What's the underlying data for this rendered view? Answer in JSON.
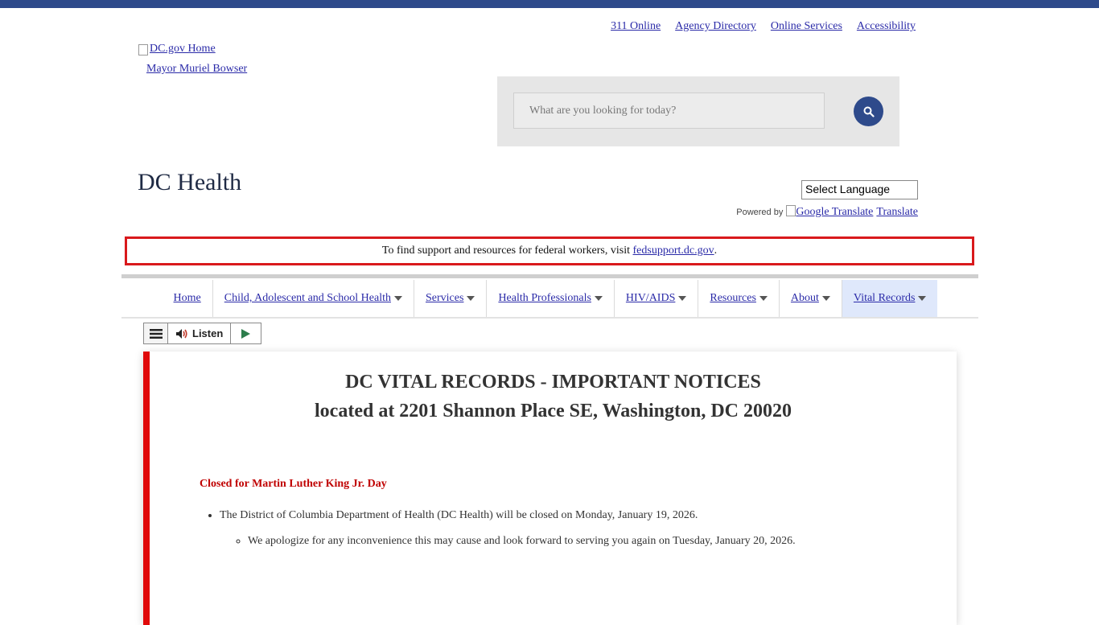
{
  "utility_links": [
    "311 Online",
    "Agency Directory",
    "Online Services",
    "Accessibility"
  ],
  "logo_alt": "DC.gov Home",
  "mayor_link": "Mayor Muriel Bowser",
  "search": {
    "placeholder": "What are you looking for today?"
  },
  "site_title": "DC Health",
  "language_select": "Select Language",
  "powered_by": "Powered by",
  "google_translate_alt": "Google Translate",
  "translate_link": "Translate",
  "alert": {
    "prefix": "To find support and resources for federal workers, visit ",
    "link": "fedsupport.dc.gov",
    "suffix": "."
  },
  "nav": [
    {
      "label": "Home",
      "dropdown": false,
      "active": false
    },
    {
      "label": "Child, Adolescent and School Health",
      "dropdown": true,
      "active": false
    },
    {
      "label": "Services",
      "dropdown": true,
      "active": false
    },
    {
      "label": "Health Professionals",
      "dropdown": true,
      "active": false
    },
    {
      "label": "HIV/AIDS",
      "dropdown": true,
      "active": false
    },
    {
      "label": "Resources",
      "dropdown": true,
      "active": false
    },
    {
      "label": "About",
      "dropdown": true,
      "active": false
    },
    {
      "label": "Vital Records",
      "dropdown": true,
      "active": true
    }
  ],
  "listen": {
    "label": "Listen"
  },
  "content": {
    "heading_1": "DC VITAL RECORDS - IMPORTANT NOTICES",
    "heading_2": "located at 2201 Shannon Place SE, Washington, DC 20020",
    "closed_title": "Closed for Martin Luther King Jr. Day",
    "bullet": "The District of Columbia Department of Health (DC Health) will be closed on Monday, January 19, 2026.",
    "sub_bullet": "We apologize for any inconvenience this may cause and look forward to serving you again on Tuesday, January 20, 2026."
  },
  "colors": {
    "brand": "#2e4a8b",
    "alert_border": "#d9191c",
    "notice_red": "#c00000",
    "active_nav": "#dfe8fb"
  }
}
